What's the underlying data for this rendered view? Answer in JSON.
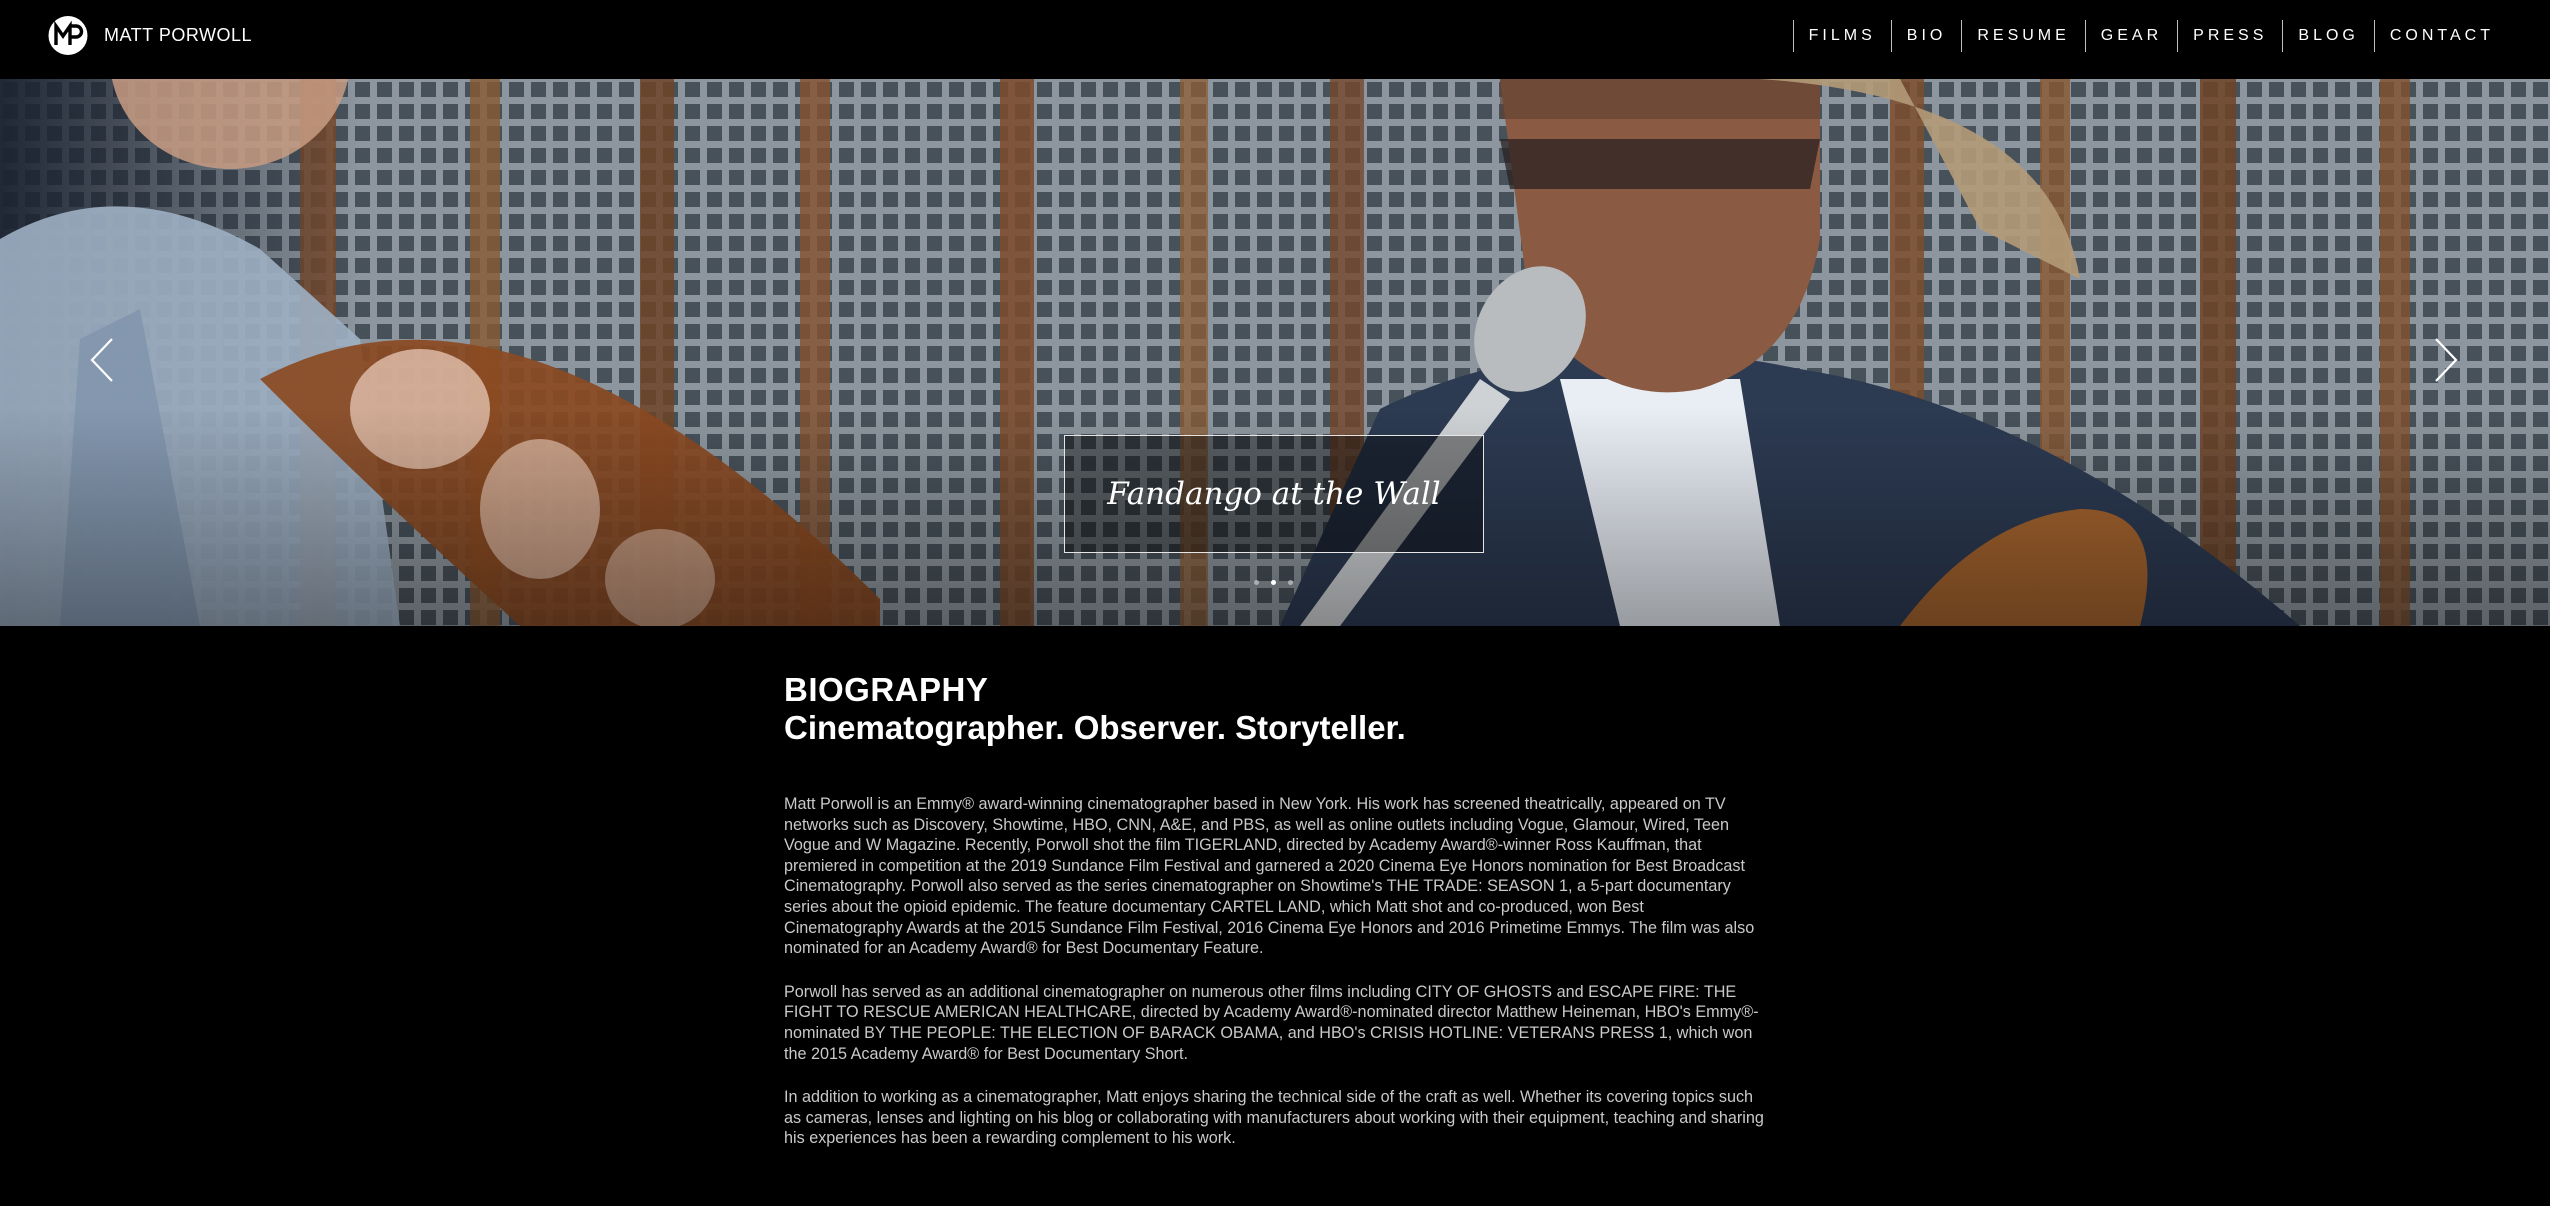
{
  "site": {
    "brand": "MATT PORWOLL",
    "logo_icon": "mp-monogram-logo"
  },
  "nav": {
    "items": [
      {
        "label": "FILMS"
      },
      {
        "label": "BIO"
      },
      {
        "label": "RESUME"
      },
      {
        "label": "GEAR"
      },
      {
        "label": "PRESS"
      },
      {
        "label": "BLOG"
      },
      {
        "label": "CONTACT"
      }
    ]
  },
  "hero": {
    "caption": "Fandango at the Wall",
    "prev_icon": "chevron-left-icon",
    "next_icon": "chevron-right-icon",
    "slide_count": 3,
    "active_slide": 1
  },
  "bio": {
    "heading": "BIOGRAPHY",
    "subtitle": "Cinematographer. Observer. Storyteller.",
    "paragraphs": [
      "Matt Porwoll is an Emmy® award-winning cinematographer based in New York. His work has screened theatrically, appeared on TV networks such as Discovery, Showtime, HBO, CNN, A&E, and PBS, as well as online outlets including Vogue, Glamour, Wired, Teen Vogue and W Magazine. Recently, Porwoll shot the film TIGERLAND, directed by Academy Award®-winner Ross Kauffman, that premiered in competition at the 2019 Sundance Film Festival and garnered a 2020 Cinema Eye Honors nomination for Best Broadcast Cinematography. Porwoll also served as the series cinematographer on Showtime's THE TRADE: SEASON 1, a 5-part documentary series about the opioid epidemic. The feature documentary CARTEL LAND, which Matt shot and co-produced, won Best Cinematography Awards at the 2015 Sundance Film Festival, 2016 Cinema Eye Honors and 2016 Primetime Emmys. The film was also nominated for an Academy Award® for Best Documentary Feature.",
      "Porwoll has served as an additional cinematographer on numerous other films including CITY OF GHOSTS and ESCAPE FIRE: THE FIGHT TO RESCUE AMERICAN HEALTHCARE, directed by Academy Award®-nominated director Matthew Heineman, HBO's Emmy®-nominated BY THE PEOPLE: THE ELECTION OF BARACK OBAMA, and HBO's CRISIS HOTLINE: VETERANS PRESS 1, which won the 2015 Academy Award® for Best Documentary Short.",
      "In addition to working as a cinematographer, Matt enjoys sharing the technical side of the craft as well. Whether its covering topics such as cameras, lenses and lighting on his blog or collaborating with manufacturers about working with their equipment, teaching and sharing his experiences has been a rewarding complement to his work."
    ]
  },
  "colors": {
    "background": "#000000",
    "text_primary": "#ffffff",
    "text_body": "#c9c9c9",
    "nav_divider": "#bfbfbf"
  }
}
